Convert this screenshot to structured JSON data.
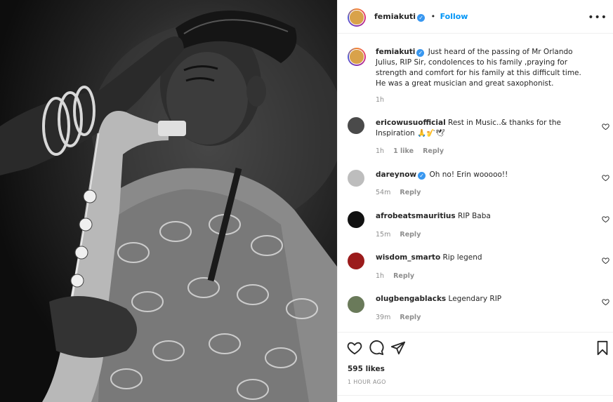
{
  "header": {
    "username": "femiakuti",
    "separator": "•",
    "follow_label": "Follow",
    "more_icon": "more-horizontal-icon"
  },
  "caption": {
    "username": "femiakuti",
    "text": "Just heard of the passing of Mr Orlando Julius, RIP Sir, condolences to his family ,praying for strength and comfort for his family at this difficult time. He was a great musician and great saxophonist.",
    "time": "1h"
  },
  "comments": [
    {
      "username": "ericowusuofficial",
      "text": "Rest in Music..& thanks for the Inspiration 🙏🎷🕊",
      "time": "1h",
      "likes": "1 like",
      "reply": "Reply",
      "verified": false
    },
    {
      "username": "dareynow",
      "text": "Oh no! Erin wooooo!!",
      "time": "54m",
      "likes": "",
      "reply": "Reply",
      "verified": true
    },
    {
      "username": "afrobeatsmauritius",
      "text": "RIP Baba",
      "time": "15m",
      "likes": "",
      "reply": "Reply",
      "verified": false
    },
    {
      "username": "wisdom_smarto",
      "text": "Rip legend",
      "time": "1h",
      "likes": "",
      "reply": "Reply",
      "verified": false
    },
    {
      "username": "olugbengablacks",
      "text": "Legendary RIP",
      "time": "39m",
      "likes": "",
      "reply": "Reply",
      "verified": false
    }
  ],
  "actions": {
    "like_icon": "heart-icon",
    "comment_icon": "comment-icon",
    "share_icon": "send-icon",
    "save_icon": "bookmark-icon",
    "likes": "595 likes",
    "age": "1 HOUR AGO"
  },
  "colors": {
    "link_blue": "#0095f6",
    "verified_blue": "#3897f0",
    "muted_text": "#8e8e8e",
    "border": "#efefef"
  }
}
